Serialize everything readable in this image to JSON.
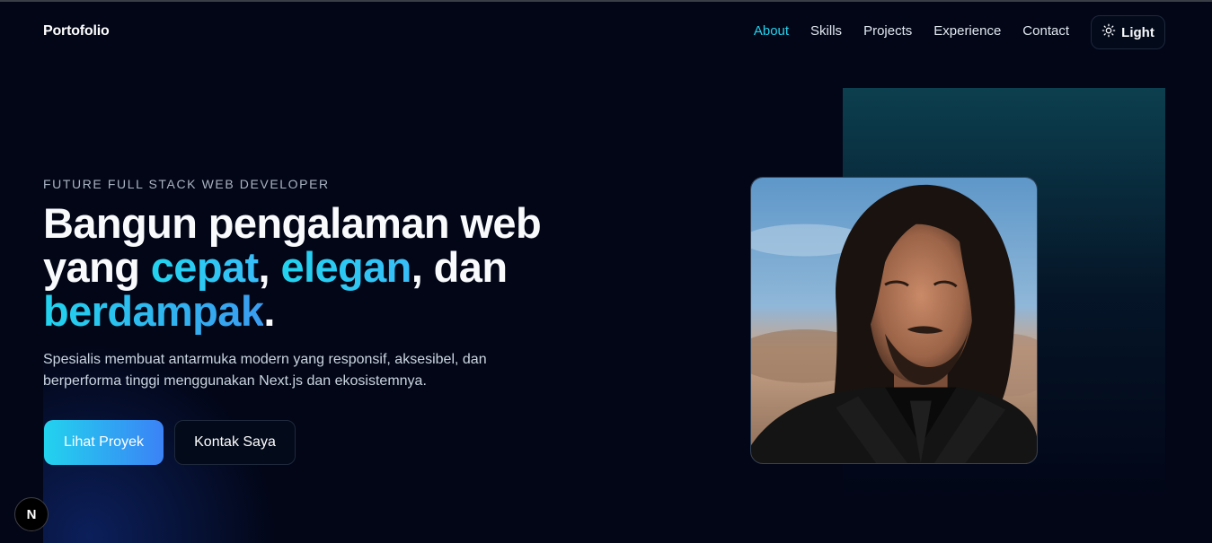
{
  "header": {
    "brand": "Portofolio",
    "nav": [
      {
        "label": "About",
        "active": true
      },
      {
        "label": "Skills",
        "active": false
      },
      {
        "label": "Projects",
        "active": false
      },
      {
        "label": "Experience",
        "active": false
      },
      {
        "label": "Contact",
        "active": false
      }
    ],
    "theme_toggle": {
      "label": "Light",
      "icon": "sun-icon"
    }
  },
  "hero": {
    "eyebrow": "FUTURE FULL STACK WEB DEVELOPER",
    "headline": {
      "part1": "Bangun pengalaman web yang ",
      "highlight1": "cepat",
      "sep1": ", ",
      "highlight2": "elegan",
      "sep2": ", dan ",
      "highlight3": "berdampak",
      "end": "."
    },
    "description": "Spesialis membuat antarmuka modern yang responsif, aksesibel, dan berperforma tinggi menggunakan Next.js dan ekosistemnya.",
    "primary_button": "Lihat Proyek",
    "secondary_button": "Kontak Saya"
  },
  "portrait": {
    "icon": "profile-photo"
  },
  "dev_badge": {
    "label": "N"
  },
  "colors": {
    "accent": "#22d3ee",
    "accent_blue": "#3b82f6",
    "background": "#020617"
  }
}
